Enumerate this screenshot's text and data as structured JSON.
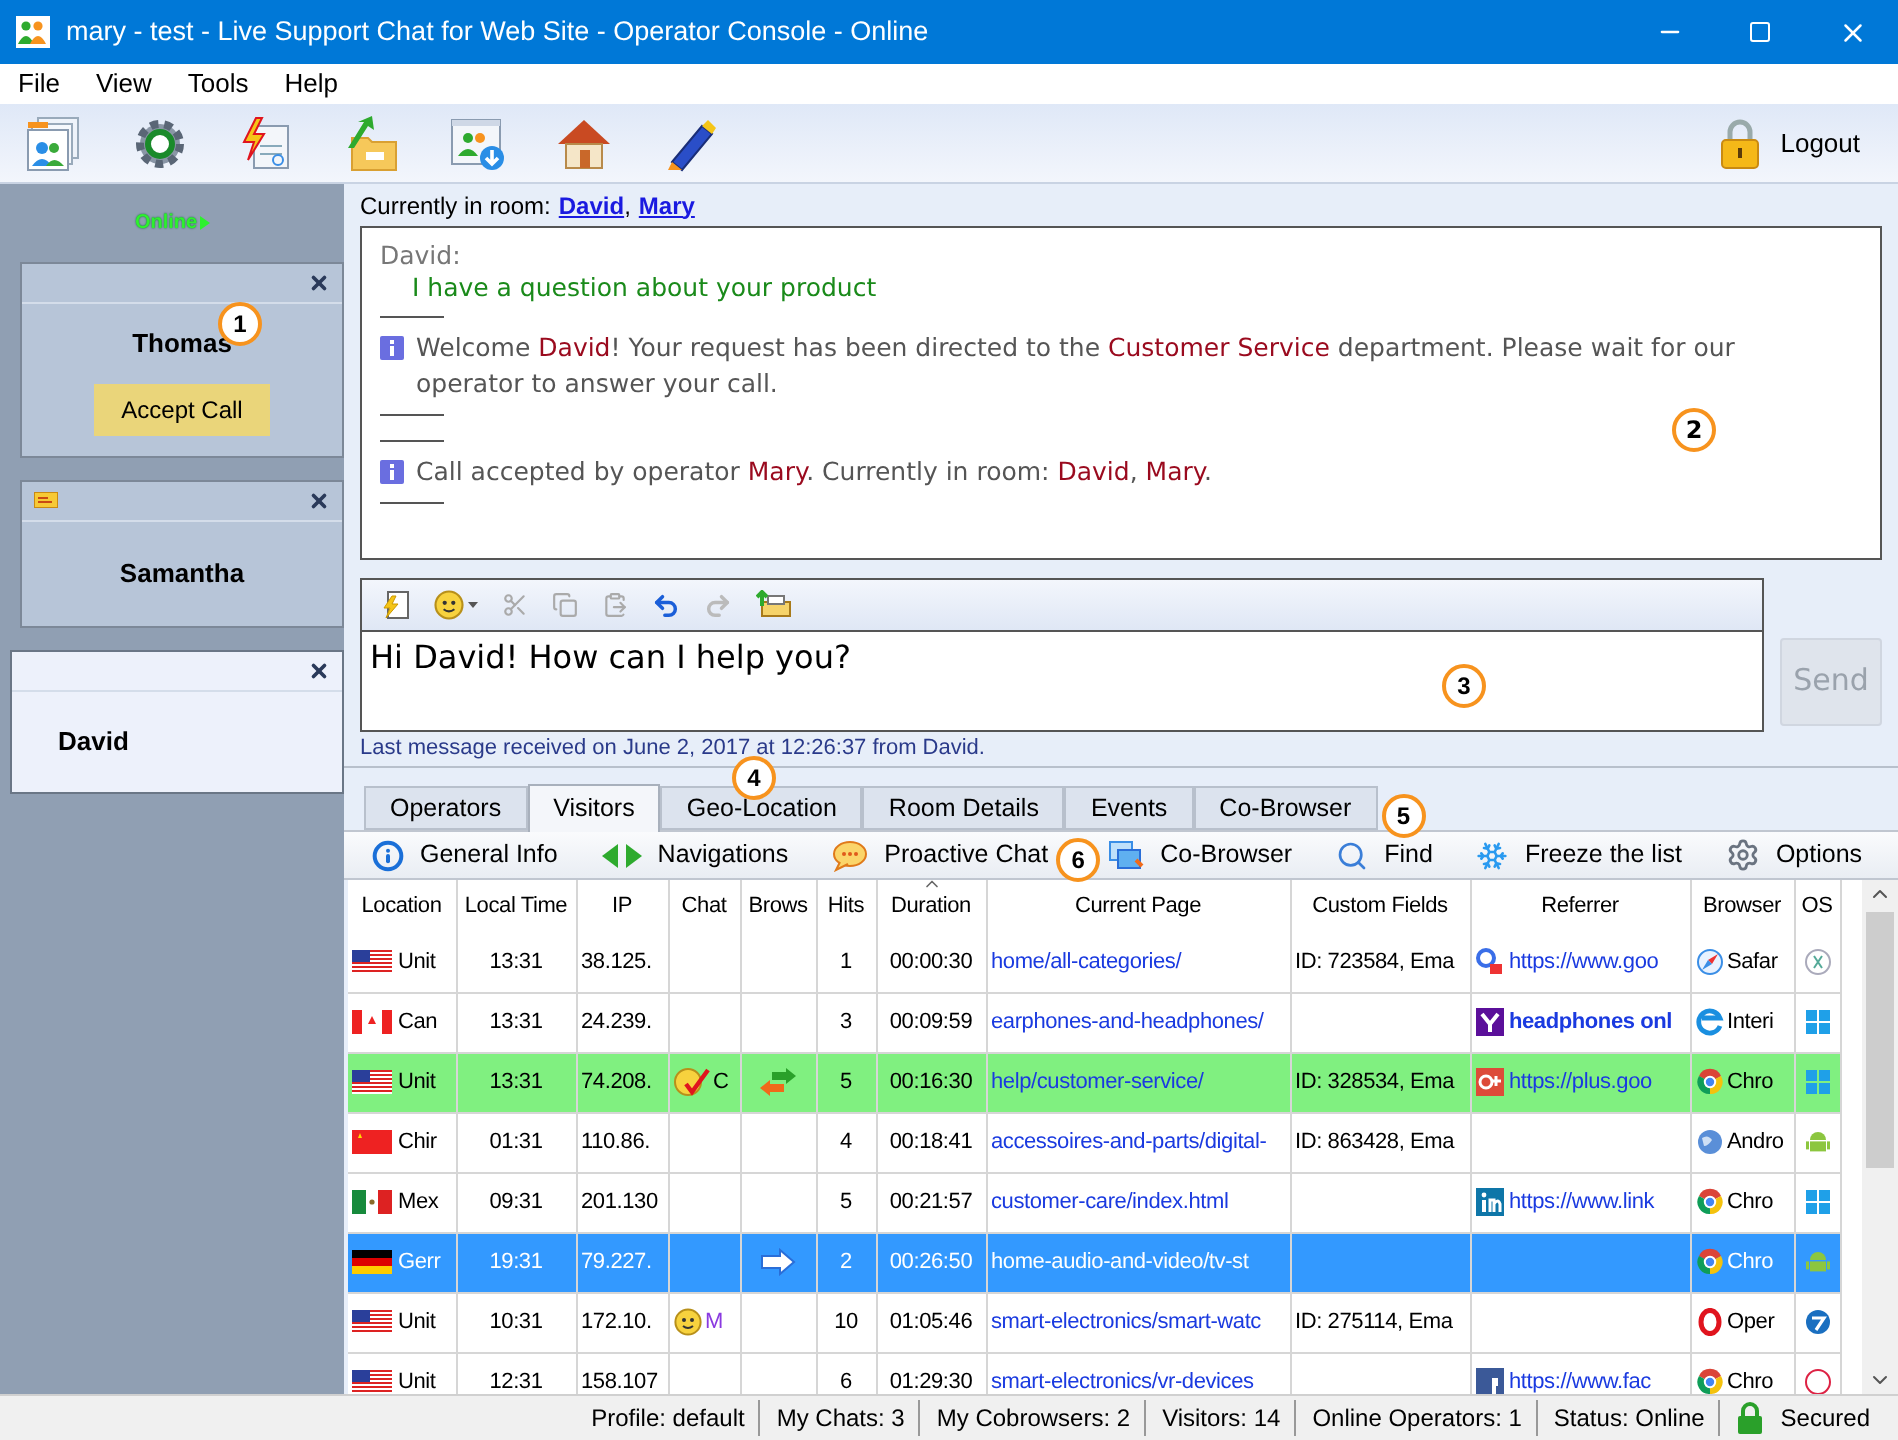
{
  "window": {
    "title": "mary - test - Live Support Chat for Web Site - Operator Console - Online"
  },
  "menu": [
    "File",
    "View",
    "Tools",
    "Help"
  ],
  "toolbar": {
    "logout": "Logout"
  },
  "sidebar": {
    "status": "Online",
    "cards": [
      {
        "name": "Thomas",
        "selected": false,
        "unread": false,
        "button": "Accept Call",
        "callout": "1"
      },
      {
        "name": "Samantha",
        "selected": false,
        "unread": true
      },
      {
        "name": "David",
        "selected": true,
        "unread": false
      }
    ]
  },
  "room": {
    "label": "Currently in room:",
    "items": [
      {
        "text": "David",
        "kind": "link"
      },
      {
        "text": ",",
        "kind": "plain"
      },
      {
        "text": "Mary",
        "kind": "link"
      }
    ]
  },
  "chat": {
    "callout": "2",
    "messages": [
      {
        "kind": "user",
        "sender": "David:",
        "text": "I have a question about your product"
      },
      {
        "kind": "system",
        "parts": [
          {
            "text": "Welcome ",
            "highlight": false
          },
          {
            "text": "David",
            "highlight": true
          },
          {
            "text": "! Your request has been directed to the ",
            "highlight": false
          },
          {
            "text": "Customer Service",
            "highlight": true
          },
          {
            "text": " department. Please wait for our operator to answer your call.",
            "highlight": false
          }
        ]
      },
      {
        "kind": "system",
        "parts": [
          {
            "text": "Call accepted by operator ",
            "highlight": false
          },
          {
            "text": "Mary",
            "highlight": true
          },
          {
            "text": ". Currently in room: ",
            "highlight": false
          },
          {
            "text": "David",
            "highlight": true
          },
          {
            "text": ", ",
            "highlight": false
          },
          {
            "text": "Mary",
            "highlight": true
          },
          {
            "text": ".",
            "highlight": false
          }
        ]
      }
    ]
  },
  "message_input": {
    "value": "Hi David! How can I help you?",
    "callout": "3"
  },
  "send_button": {
    "label": "Send",
    "disabled": true
  },
  "last_message": "Last message received on June 2, 2017 at 12:26:37 from David.",
  "tabs_callout": "4",
  "tabs": [
    {
      "label": "Operators",
      "selected": false
    },
    {
      "label": "Visitors",
      "selected": true
    },
    {
      "label": "Geo-Location",
      "selected": false
    },
    {
      "label": "Room Details",
      "selected": false
    },
    {
      "label": "Events",
      "selected": false
    },
    {
      "label": "Co-Browser",
      "selected": false
    }
  ],
  "tabs_end_callout": "5",
  "visitor_toolbar": [
    {
      "label": "General Info",
      "kind": "info"
    },
    {
      "label": "Navigations",
      "kind": "nav"
    },
    {
      "label": "Proactive Chat",
      "kind": "chat",
      "callout": "6"
    },
    {
      "label": "Co-Browser",
      "kind": "cobrowse"
    },
    {
      "label": "Find",
      "kind": "find"
    },
    {
      "label": "Freeze the list",
      "kind": "freeze"
    },
    {
      "label": "Options",
      "kind": "options"
    }
  ],
  "table": {
    "columns": [
      {
        "label": "Location",
        "sorted": false
      },
      {
        "label": "Local Time",
        "sorted": false
      },
      {
        "label": "IP",
        "sorted": false
      },
      {
        "label": "Chat",
        "sorted": false
      },
      {
        "label": "Brows",
        "sorted": false
      },
      {
        "label": "Hits",
        "sorted": false
      },
      {
        "label": "Duration",
        "sorted": true
      },
      {
        "label": "Current Page",
        "sorted": false
      },
      {
        "label": "Custom Fields",
        "sorted": false
      },
      {
        "label": "Referrer",
        "sorted": false
      },
      {
        "label": "Browser",
        "sorted": false
      },
      {
        "label": "OS",
        "sorted": false
      }
    ],
    "rows": [
      {
        "selected": false,
        "highlighted": false,
        "location": {
          "kind": "us",
          "text": "Unit"
        },
        "time": "13:31",
        "ip": "38.125.",
        "chat": null,
        "brows": null,
        "hits": "1",
        "duration": "00:00:30",
        "page": "home/all-categories/",
        "custom": "ID: 723584, Ema",
        "referrer": {
          "kind": "google",
          "text": "https://www.goo",
          "bold": false
        },
        "browser": {
          "kind": "safari",
          "text": "Safar"
        },
        "os": {
          "kind": "mac"
        }
      },
      {
        "selected": false,
        "highlighted": false,
        "location": {
          "kind": "ca",
          "text": "Can"
        },
        "time": "13:31",
        "ip": "24.239.",
        "chat": null,
        "brows": null,
        "hits": "3",
        "duration": "00:09:59",
        "page": "earphones-and-headphones/",
        "custom": "",
        "referrer": {
          "kind": "yahoo",
          "text": "headphones onl",
          "bold": true
        },
        "browser": {
          "kind": "ie",
          "text": "Interi"
        },
        "os": {
          "kind": "win10"
        }
      },
      {
        "selected": false,
        "highlighted": true,
        "location": {
          "kind": "us",
          "text": "Unit"
        },
        "time": "13:31",
        "ip": "74.208.",
        "chat": {
          "kind": "accepted",
          "text": "C"
        },
        "brows": {
          "kind": "exchange"
        },
        "hits": "5",
        "duration": "00:16:30",
        "page": "help/customer-service/",
        "custom": "ID: 328534, Ema",
        "referrer": {
          "kind": "gplus",
          "text": "https://plus.goo",
          "bold": false
        },
        "browser": {
          "kind": "chrome",
          "text": "Chro"
        },
        "os": {
          "kind": "win"
        }
      },
      {
        "selected": false,
        "highlighted": false,
        "location": {
          "kind": "cn",
          "text": "Chir"
        },
        "time": "01:31",
        "ip": "110.86.",
        "chat": null,
        "brows": null,
        "hits": "4",
        "duration": "00:18:41",
        "page": "accessoires-and-parts/digital-",
        "custom": "ID: 863428, Ema",
        "referrer": null,
        "browser": {
          "kind": "globe",
          "text": "Andro"
        },
        "os": {
          "kind": "android"
        }
      },
      {
        "selected": false,
        "highlighted": false,
        "location": {
          "kind": "mx",
          "text": "Mex"
        },
        "time": "09:31",
        "ip": "201.130",
        "chat": null,
        "brows": null,
        "hits": "5",
        "duration": "00:21:57",
        "page": "customer-care/index.html",
        "custom": "",
        "referrer": {
          "kind": "linkedin",
          "text": "https://www.link",
          "bold": false
        },
        "browser": {
          "kind": "chrome",
          "text": "Chro"
        },
        "os": {
          "kind": "win10"
        }
      },
      {
        "selected": true,
        "highlighted": false,
        "location": {
          "kind": "de",
          "text": "Gerr"
        },
        "time": "19:31",
        "ip": "79.227.",
        "chat": null,
        "brows": {
          "kind": "arrow"
        },
        "hits": "2",
        "duration": "00:26:50",
        "page": "home-audio-and-video/tv-st",
        "custom": "",
        "referrer": null,
        "browser": {
          "kind": "chrome",
          "text": "Chro"
        },
        "os": {
          "kind": "android"
        }
      },
      {
        "selected": false,
        "highlighted": false,
        "location": {
          "kind": "us",
          "text": "Unit"
        },
        "time": "10:31",
        "ip": "172.10.",
        "chat": {
          "kind": "waiting",
          "text": "M"
        },
        "brows": null,
        "hits": "10",
        "duration": "01:05:46",
        "page": "smart-electronics/smart-watc",
        "custom": "ID: 275114, Ema",
        "referrer": null,
        "browser": {
          "kind": "opera",
          "text": "Oper"
        },
        "os": {
          "kind": "win7"
        }
      },
      {
        "selected": false,
        "highlighted": false,
        "location": {
          "kind": "us",
          "text": "Unit"
        },
        "time": "12:31",
        "ip": "158.107",
        "chat": null,
        "brows": null,
        "hits": "6",
        "duration": "01:29:30",
        "page": "smart-electronics/vr-devices",
        "custom": "",
        "referrer": {
          "kind": "facebook",
          "text": "https://www.fac",
          "bold": false
        },
        "browser": {
          "kind": "chrome",
          "text": "Chro"
        },
        "os": {
          "kind": "other"
        }
      }
    ]
  },
  "status_bar": [
    {
      "text": "Profile: default",
      "kind": "plain"
    },
    {
      "text": "My Chats: 3",
      "kind": "plain"
    },
    {
      "text": "My Cobrowsers: 2",
      "kind": "plain"
    },
    {
      "text": "Visitors: 14",
      "kind": "plain"
    },
    {
      "text": "Online Operators: 1",
      "kind": "plain"
    },
    {
      "text": "Status: Online",
      "kind": "plain"
    },
    {
      "text": "Secured",
      "kind": "secure"
    }
  ]
}
